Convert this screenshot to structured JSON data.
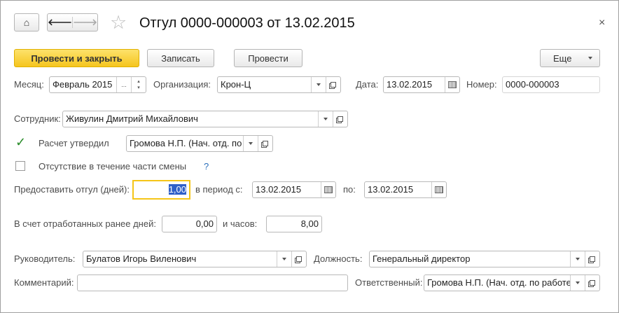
{
  "title": "Отгул 0000-000003 от 13.02.2015",
  "close": "×",
  "toolbar": {
    "post_close": "Провести и закрыть",
    "save": "Записать",
    "post": "Провести",
    "more": "Еще"
  },
  "fields": {
    "month_label": "Месяц:",
    "month": "Февраль 2015",
    "month_btn": "...",
    "org_label": "Организация:",
    "org": "Крон-Ц",
    "date_label": "Дата:",
    "date": "13.02.2015",
    "number_label": "Номер:",
    "number": "0000-000003",
    "employee_label": "Сотрудник:",
    "employee": "Живулин Дмитрий Михайлович",
    "approved_label": "Расчет утвердил",
    "approved_checked": true,
    "approved_by": "Громова Н.П. (Нач. отд. по",
    "partial_label": "Отсутствие в течение части смены",
    "partial_checked": false,
    "help": "?",
    "days_label": "Предоставить отгул (дней):",
    "days": "1,00",
    "from_label": "в период с:",
    "from": "13.02.2015",
    "to_label": "по:",
    "to": "13.02.2015",
    "worked_days_label": "В счет отработанных ранее дней:",
    "worked_days": "0,00",
    "hours_label": "и часов:",
    "hours": "8,00",
    "manager_label": "Руководитель:",
    "manager": "Булатов Игорь Виленович",
    "position_label": "Должность:",
    "position": "Генеральный директор",
    "comment_label": "Комментарий:",
    "comment": "",
    "responsible_label": "Ответственный:",
    "responsible": "Громова Н.П. (Нач. отд. по работе"
  }
}
